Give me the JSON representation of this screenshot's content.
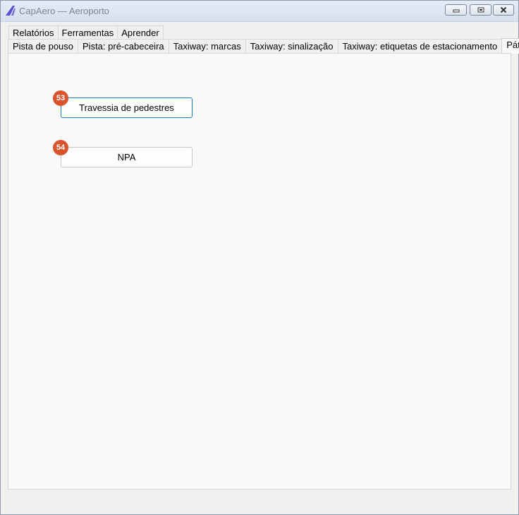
{
  "window": {
    "title": "CapAero — Aeroporto",
    "controls": {
      "minimize": "minimize-icon",
      "maximize": "maximize-icon",
      "close": "close-icon"
    }
  },
  "menu_tabs": [
    "Relatórios",
    "Ferramentas",
    "Aprender"
  ],
  "tabs": [
    {
      "label": "Pista de pouso",
      "active": false
    },
    {
      "label": "Pista: pré-cabeceira",
      "active": false
    },
    {
      "label": "Taxiway: marcas",
      "active": false
    },
    {
      "label": "Taxiway: sinalização",
      "active": false
    },
    {
      "label": "Taxiway: etiquetas de estacionamento",
      "active": false
    },
    {
      "label": "Pátio",
      "active": true
    }
  ],
  "panel": {
    "buttons": [
      {
        "badge": "53",
        "label": "Travessia de pedestres",
        "focused": true
      },
      {
        "badge": "54",
        "label": "NPA",
        "focused": false
      }
    ]
  },
  "colors": {
    "badge": "#d9532c",
    "focus_border": "#1a7ab6",
    "app_icon": "#5a4fcf"
  }
}
